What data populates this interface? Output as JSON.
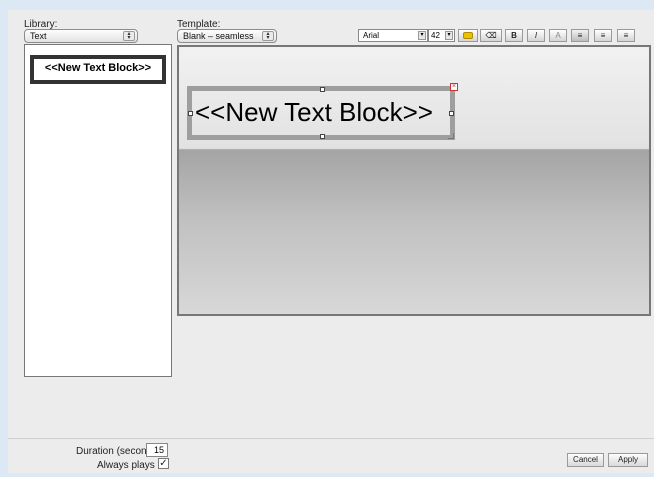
{
  "library": {
    "label": "Library:",
    "value": "Text"
  },
  "template": {
    "label": "Template:",
    "value": "Blank – seamless"
  },
  "toolbar": {
    "font": "Arial",
    "size": "42",
    "bold": "B",
    "italic": "I",
    "text_color": "A"
  },
  "thumbnail": {
    "text": "<<New Text Block>>"
  },
  "canvas": {
    "text": "<<New Text Block>>"
  },
  "footer": {
    "duration_label": "Duration (seconds)",
    "duration_value": "15",
    "always_plays_label": "Always plays",
    "always_plays_checked": true,
    "cancel": "Cancel",
    "apply": "Apply"
  }
}
